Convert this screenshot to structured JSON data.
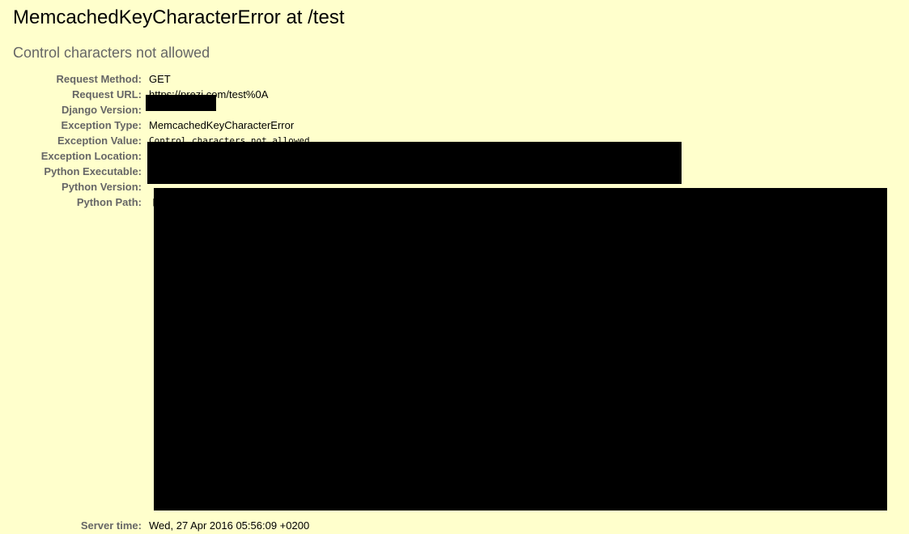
{
  "summary": {
    "title": "MemcachedKeyCharacterError at /test",
    "subtitle": "Control characters not allowed"
  },
  "meta": [
    {
      "label": "Request Method:",
      "value": "GET"
    },
    {
      "label": "Request URL:",
      "value": "https://prezi.com/test%0A"
    },
    {
      "label": "Django Version:",
      "value": ""
    },
    {
      "label": "Exception Type:",
      "value": "MemcachedKeyCharacterError"
    },
    {
      "label": "Exception Value:",
      "value": "Control characters not allowed"
    },
    {
      "label": "Exception Location:",
      "value": ""
    },
    {
      "label": "Python Executable:",
      "value": ""
    },
    {
      "label": "Python Version:",
      "value": ""
    },
    {
      "label": "Python Path:",
      "value": "["
    },
    {
      "label": "Server time:",
      "value": "Wed, 27 Apr 2016 05:56:09 +0200"
    }
  ],
  "colors": {
    "background": "#ffffcc",
    "label": "#666666",
    "redaction": "#000000"
  }
}
